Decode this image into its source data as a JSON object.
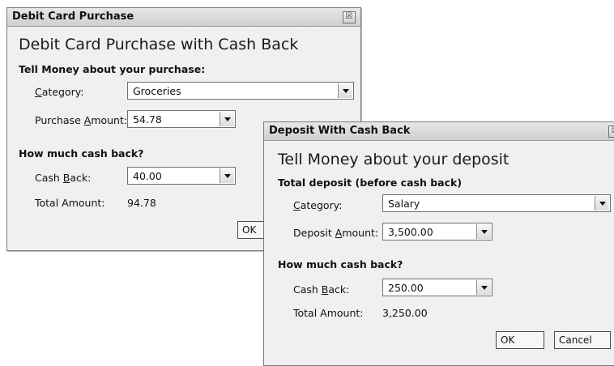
{
  "debit_dialog": {
    "title": "Debit Card Purchase",
    "close_symbol": "☒",
    "heading": "Debit Card Purchase with Cash Back",
    "section1": "Tell Money about your purchase:",
    "category_label": {
      "mnemonic": "C",
      "rest": "ategory:"
    },
    "category_value": "Groceries",
    "purchase_label": {
      "pre": "Purchase ",
      "mnemonic": "A",
      "rest": "mount:"
    },
    "purchase_value": "54.78",
    "section2": "How much cash back?",
    "cashback_label": {
      "pre": "Cash ",
      "mnemonic": "B",
      "rest": "ack:"
    },
    "cashback_value": "40.00",
    "total_label": "Total Amount:",
    "total_value": "94.78",
    "ok_label": "OK"
  },
  "deposit_dialog": {
    "title": "Deposit With Cash Back",
    "close_symbol": "☒",
    "heading": "Tell Money about your deposit",
    "section1": "Total deposit (before cash back)",
    "category_label": {
      "mnemonic": "C",
      "rest": "ategory:"
    },
    "category_value": "Salary",
    "deposit_label": {
      "pre": "Deposit ",
      "mnemonic": "A",
      "rest": "mount:"
    },
    "deposit_value": "3,500.00",
    "section2": "How much cash back?",
    "cashback_label": {
      "pre": "Cash ",
      "mnemonic": "B",
      "rest": "ack:"
    },
    "cashback_value": "250.00",
    "total_label": "Total Amount:",
    "total_value": "3,250.00",
    "ok_label": "OK",
    "cancel_label": "Cancel"
  }
}
